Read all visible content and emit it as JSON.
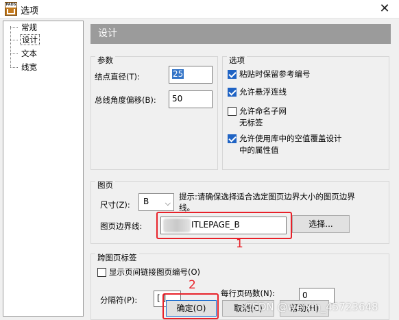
{
  "window": {
    "title": "选项",
    "close_glyph": "✕",
    "app_logo_text": "PADS"
  },
  "tree": {
    "items": [
      "常规",
      "设计",
      "文本",
      "线宽"
    ],
    "selected_index": 1
  },
  "panel": {
    "header": "设计"
  },
  "params": {
    "title": "参数",
    "node_diameter_label": "结点直径(T):",
    "node_diameter_value": "25",
    "bus_angle_label": "总线角度偏移(B):",
    "bus_angle_value": "50"
  },
  "options": {
    "title": "选项",
    "items": [
      {
        "label": "粘贴时保留参考编号",
        "checked": true
      },
      {
        "label": "允许悬浮连线",
        "checked": true
      },
      {
        "label": "允许命名子网\n无标签",
        "checked": false
      },
      {
        "label": "允许使用库中的空值覆盖设计\n中的属性值",
        "checked": true
      }
    ]
  },
  "sheet": {
    "title": "图页",
    "size_label": "尺寸(Z):",
    "size_value": "B",
    "hint": "提示:请确保选择适合选定图页边界大小的图页边界线。",
    "border_label": "图页边界线:",
    "border_value": "ITLEPAGE_B",
    "select_button": "选择..."
  },
  "cross": {
    "title": "跨图页标签",
    "show_label": "显示页间链接图页编号(O)",
    "show_checked": false,
    "separator_label": "分隔符(P):",
    "separator_value": "[ ]",
    "per_row_label": "每行页码数(N):",
    "per_row_value": "0"
  },
  "footer": {
    "ok": "确定(O)",
    "cancel": "取消(C)",
    "help": "帮助(H)"
  },
  "annotations": {
    "mark1": "1",
    "mark2": "2"
  },
  "watermark": "CSDN @weixin_45723648",
  "colors": {
    "header_bg": "#9b9b9b",
    "checkbox_on": "#1f63c4",
    "annotation_red": "#e8222a"
  }
}
